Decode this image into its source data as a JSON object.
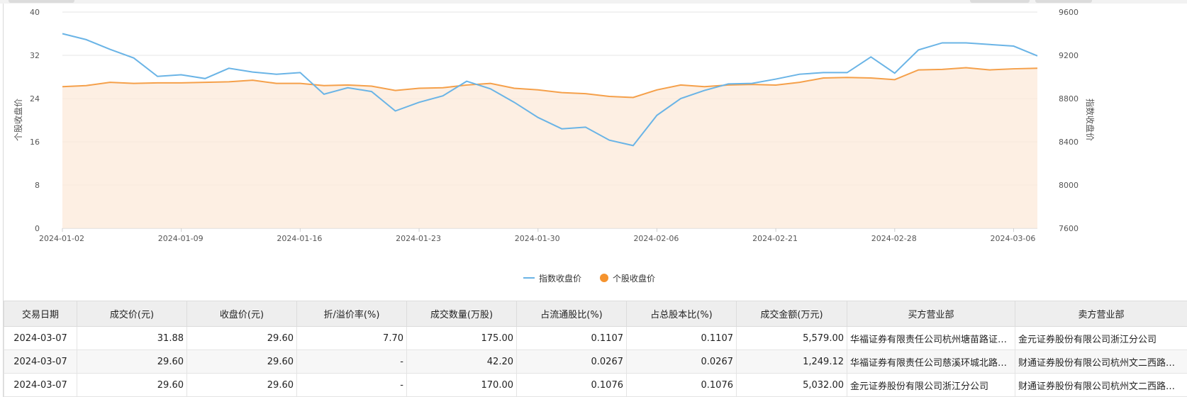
{
  "chart_data": {
    "type": "line",
    "x": [
      "2024-01-02",
      "2024-01-03",
      "2024-01-04",
      "2024-01-05",
      "2024-01-08",
      "2024-01-09",
      "2024-01-10",
      "2024-01-11",
      "2024-01-12",
      "2024-01-15",
      "2024-01-16",
      "2024-01-17",
      "2024-01-18",
      "2024-01-19",
      "2024-01-22",
      "2024-01-23",
      "2024-01-24",
      "2024-01-25",
      "2024-01-26",
      "2024-01-29",
      "2024-01-30",
      "2024-01-31",
      "2024-02-01",
      "2024-02-02",
      "2024-02-05",
      "2024-02-06",
      "2024-02-07",
      "2024-02-08",
      "2024-02-19",
      "2024-02-20",
      "2024-02-21",
      "2024-02-22",
      "2024-02-23",
      "2024-02-26",
      "2024-02-27",
      "2024-02-28",
      "2024-02-29",
      "2024-03-01",
      "2024-03-04",
      "2024-03-05",
      "2024-03-06",
      "2024-03-07"
    ],
    "x_ticks": [
      "2024-01-02",
      "2024-01-09",
      "2024-01-16",
      "2024-01-23",
      "2024-01-30",
      "2024-02-06",
      "2024-02-21",
      "2024-02-28",
      "2024-03-06"
    ],
    "series": [
      {
        "name": "指数收盘价",
        "axis": "right",
        "color": "#6ab4e6",
        "values": [
          9400,
          9345,
          9255,
          9175,
          9005,
          9020,
          8985,
          9080,
          9045,
          9025,
          9040,
          8840,
          8900,
          8865,
          8685,
          8765,
          8825,
          8960,
          8890,
          8765,
          8625,
          8520,
          8535,
          8415,
          8365,
          8645,
          8800,
          8875,
          8935,
          8940,
          8980,
          9025,
          9040,
          9040,
          9185,
          9035,
          9250,
          9315,
          9315,
          9300,
          9285,
          9195
        ]
      },
      {
        "name": "个股收盘价",
        "axis": "left",
        "color": "#f5a04a",
        "values": [
          26.2,
          26.4,
          27.0,
          26.8,
          26.9,
          26.9,
          27.0,
          27.1,
          27.4,
          26.8,
          26.8,
          26.4,
          26.5,
          26.3,
          25.5,
          25.9,
          26.0,
          26.5,
          26.8,
          25.9,
          25.6,
          25.1,
          24.9,
          24.4,
          24.2,
          25.6,
          26.5,
          26.2,
          26.5,
          26.6,
          26.5,
          27.0,
          27.8,
          27.9,
          27.8,
          27.5,
          29.3,
          29.4,
          29.7,
          29.3,
          29.5,
          29.6
        ]
      }
    ],
    "y_left": {
      "label": "个股收盘价",
      "range": [
        0,
        40
      ],
      "ticks": [
        "0",
        "8",
        "16",
        "24",
        "32",
        "40"
      ]
    },
    "y_right": {
      "label": "指数收盘价",
      "range": [
        7600,
        9600
      ],
      "ticks": [
        "7600",
        "8000",
        "8400",
        "8800",
        "9200",
        "9600"
      ]
    },
    "legend": {
      "position": "bottom-center",
      "items": [
        "指数收盘价",
        "个股收盘价"
      ]
    },
    "grid": true
  },
  "table": {
    "columns": [
      "交易日期",
      "成交价(元)",
      "收盘价(元)",
      "折/溢价率(%)",
      "成交数量(万股)",
      "占流通股比(%)",
      "占总股本比(%)",
      "成交金额(万元)",
      "买方营业部",
      "卖方营业部"
    ],
    "rows": [
      [
        "2024-03-07",
        "31.88",
        "29.60",
        "7.70",
        "175.00",
        "0.1107",
        "0.1107",
        "5,579.00",
        "华福证券有限责任公司杭州塘苗路证券营业部",
        "金元证券股份有限公司浙江分公司"
      ],
      [
        "2024-03-07",
        "29.60",
        "29.60",
        "-",
        "42.20",
        "0.0267",
        "0.0267",
        "1,249.12",
        "华福证券有限责任公司慈溪环城北路证券营业部",
        "财通证券股份有限公司杭州文二西路证券营业部"
      ],
      [
        "2024-03-07",
        "29.60",
        "29.60",
        "-",
        "170.00",
        "0.1076",
        "0.1076",
        "5,032.00",
        "金元证券股份有限公司浙江分公司",
        "财通证券股份有限公司杭州文二西路证券营业部"
      ]
    ]
  }
}
